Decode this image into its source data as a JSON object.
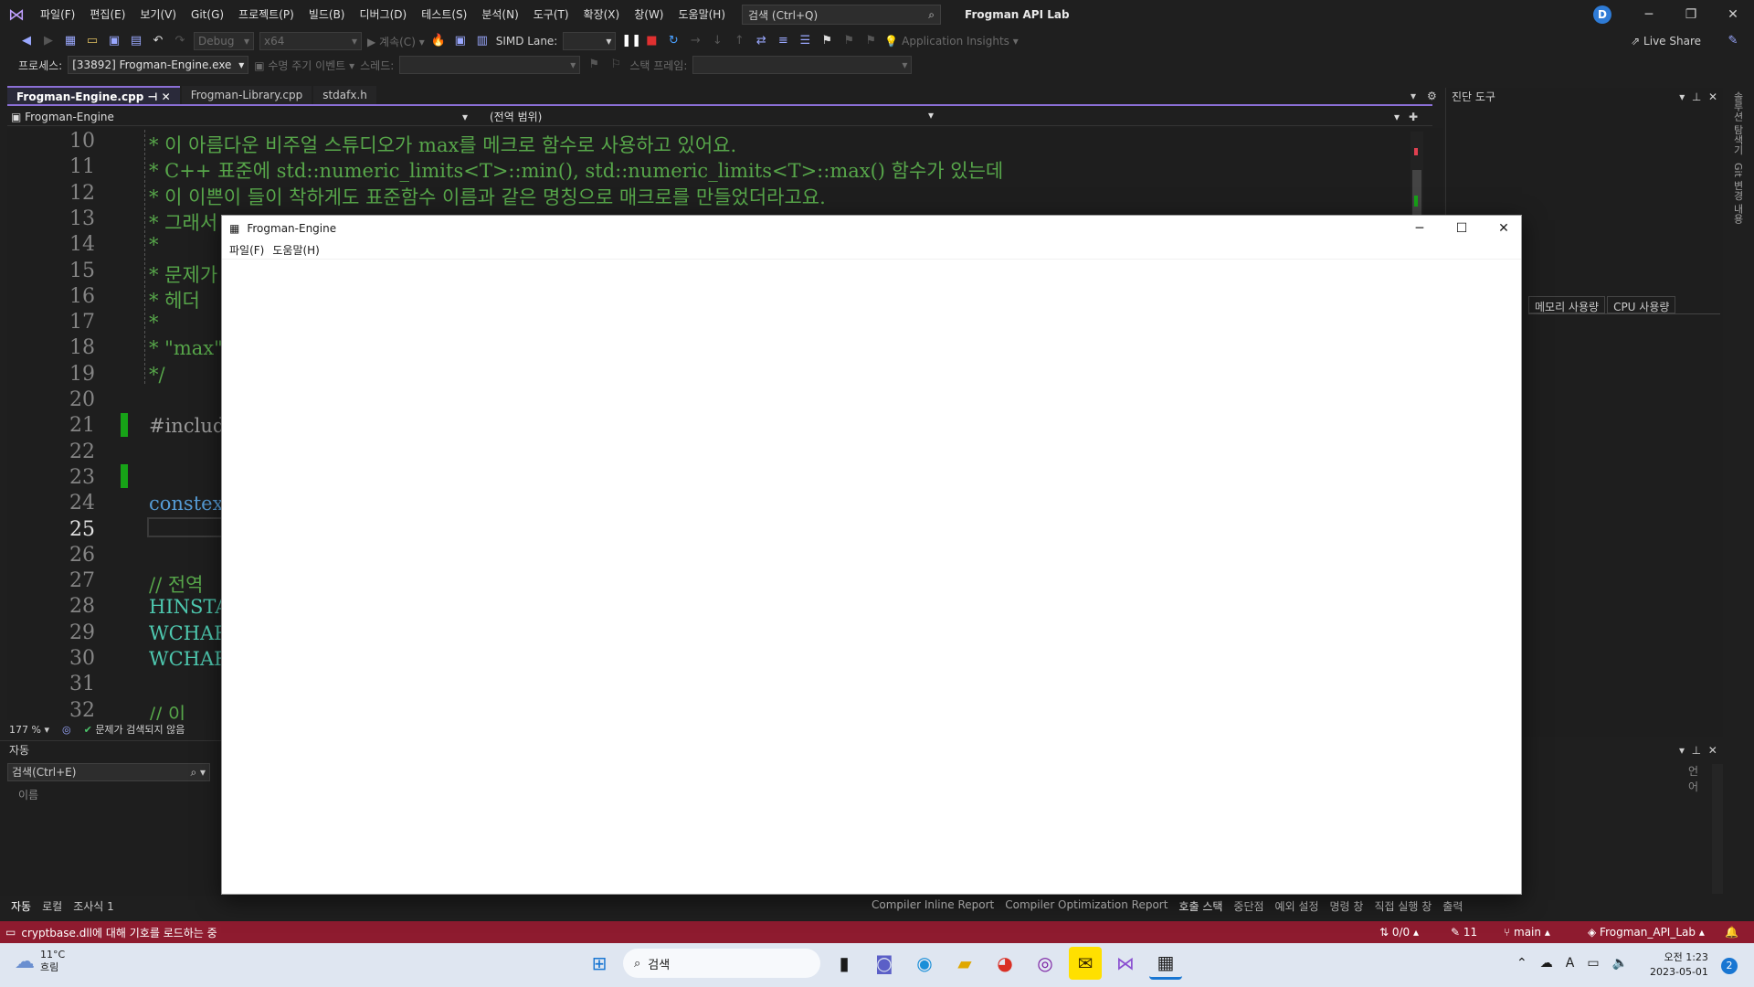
{
  "menubar": {
    "items": [
      "파일(F)",
      "편집(E)",
      "보기(V)",
      "Git(G)",
      "프로젝트(P)",
      "빌드(B)",
      "디버그(D)",
      "테스트(S)",
      "분석(N)",
      "도구(T)",
      "확장(X)",
      "창(W)",
      "도움말(H)"
    ],
    "search_placeholder": "검색 (Ctrl+Q)",
    "project_title": "Frogman API Lab",
    "avatar_letter": "D",
    "live_share": "Live Share"
  },
  "toolbar": {
    "config": "Debug",
    "platform": "x64",
    "continue_label": "계속(C)",
    "simd_lane": "SIMD Lane:",
    "app_insights": "Application Insights",
    "process_label": "프로세스:",
    "process_value": "[33892] Frogman-Engine.exe",
    "lifecycle_label": "수명 주기 이벤트",
    "thread_label": "스레드:",
    "stack_frame_label": "스택 프레임:"
  },
  "tabs": [
    {
      "label": "Frogman-Engine.cpp",
      "active": true
    },
    {
      "label": "Frogman-Library.cpp",
      "active": false
    },
    {
      "label": "stdafx.h",
      "active": false
    }
  ],
  "navbar": {
    "project": "Frogman-Engine",
    "scope": "(전역 범위)"
  },
  "code_lines": [
    {
      "num": "10",
      "text": "* 이 아름다운 비주얼 스튜디오가 max를 메크로 함수로 사용하고 있어요.",
      "cls": "c-green"
    },
    {
      "num": "11",
      "text": "* C++ 표준에 std::numeric_limits<T>::min(), std::numeric_limits<T>::max() 함수가 있는데",
      "cls": "c-green"
    },
    {
      "num": "12",
      "text": "* 이 이쁜이 들이 착하게도 표준함수 이름과 같은 명칭으로 매크로를 만들었더라고요.",
      "cls": "c-green"
    },
    {
      "num": "13",
      "text": "* 그래서 B",
      "cls": "c-green"
    },
    {
      "num": "14",
      "text": "*",
      "cls": "c-green"
    },
    {
      "num": "15",
      "text": "* 문제가",
      "cls": "c-green"
    },
    {
      "num": "16",
      "text": "* 헤더",
      "cls": "c-green"
    },
    {
      "num": "17",
      "text": "*",
      "cls": "c-green"
    },
    {
      "num": "18",
      "text": "* \"max\"",
      "cls": "c-green"
    },
    {
      "num": "19",
      "text": "*/",
      "cls": "c-green"
    },
    {
      "num": "20",
      "text": "",
      "cls": "c-white"
    },
    {
      "num": "21",
      "text": "#includ",
      "cls": "c-purple"
    },
    {
      "num": "22",
      "text": "",
      "cls": "c-white"
    },
    {
      "num": "23",
      "text": "",
      "cls": "c-white"
    },
    {
      "num": "24",
      "text": "constex",
      "cls": "c-blue"
    },
    {
      "num": "25",
      "text": "",
      "cls": "c-white"
    },
    {
      "num": "26",
      "text": "",
      "cls": "c-white"
    },
    {
      "num": "27",
      "text": "// 전역",
      "cls": "c-green"
    },
    {
      "num": "28",
      "text": "HINSTAN",
      "cls": "c-teal"
    },
    {
      "num": "29",
      "text": "WCHAR s",
      "cls": "c-teal"
    },
    {
      "num": "30",
      "text": "WCHAR s",
      "cls": "c-teal"
    },
    {
      "num": "31",
      "text": "",
      "cls": "c-white"
    },
    {
      "num": "32",
      "text": "// 이 ",
      "cls": "c-green"
    }
  ],
  "editor_status": {
    "zoom": "177 %",
    "issues": "문제가 검색되지 않음"
  },
  "diag_panel": {
    "title": "진단 도구",
    "tab_memory": "메모리 사용량",
    "tab_cpu": "CPU 사용량"
  },
  "right_rail": [
    "솔루션 탐색기",
    "Git 변경 내용"
  ],
  "locals_panel": {
    "title": "자동",
    "search_placeholder": "검색(Ctrl+E)",
    "col_name": "이름",
    "col_lang": "언어"
  },
  "bottom_tabs_left": [
    "자동",
    "로컬",
    "조사식 1"
  ],
  "bottom_tabs_right": [
    "Compiler Inline Report",
    "Compiler Optimization Report",
    "호출 스택",
    "중단점",
    "예외 설정",
    "명령 창",
    "직접 실행 창",
    "출력"
  ],
  "vs_status": {
    "message": "cryptbase.dll에 대해 기호를 로드하는 중",
    "updown": "0/0",
    "pencil": "11",
    "branch": "main",
    "repo": "Frogman_API_Lab"
  },
  "taskbar": {
    "weather_temp": "11°C",
    "weather_desc": "흐림",
    "search": "검색",
    "time": "오전 1:23",
    "date": "2023-05-01",
    "notif_count": "2"
  },
  "app_window": {
    "title": "Frogman-Engine",
    "menu": [
      "파일(F)",
      "도움말(H)"
    ]
  },
  "colors": {
    "accent": "#8b6fd6",
    "status_bar": "#8e1b2f",
    "comment": "#57a64a"
  }
}
